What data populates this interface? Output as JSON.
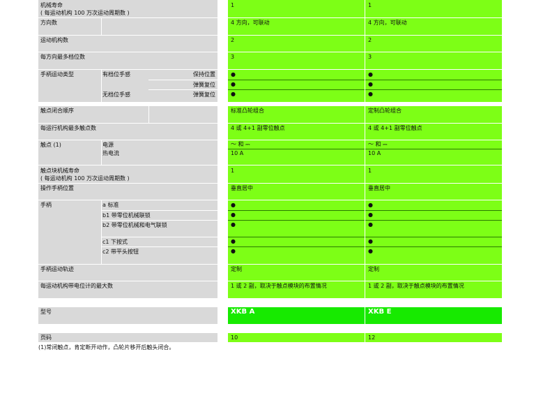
{
  "rows": {
    "mech_life": {
      "label": "机械寿命",
      "sub": "( 每运动机构 100 万次运动周期数 )",
      "a": "1",
      "e": "1"
    },
    "directions": {
      "label": "方向数",
      "a": "4 方向，可联动",
      "e": "4 方向，可联动"
    },
    "mechanisms": {
      "label": "运动机构数",
      "a": "2",
      "e": "2"
    },
    "positions": {
      "label": "每方向最多档位数",
      "a": "3",
      "e": "3"
    },
    "handle_type": {
      "label": "手柄运动类型",
      "detent": "有档位手感",
      "no_detent": "无档位手感",
      "hold": "保持位置",
      "spring1": "弹簧复位",
      "spring2": "弹簧复位",
      "a": [
        "●",
        "●",
        "●"
      ],
      "e": [
        "●",
        "●",
        "●"
      ]
    },
    "contact_seq": {
      "label": "触点闭合顺序",
      "a": "标准凸轮组合",
      "e": "定制凸轮组合"
    },
    "max_contacts": {
      "label": "每运行机构最多触点数",
      "a": "4 或 4+1 副零位触点",
      "e": "4 或 4+1 副零位触点"
    },
    "contacts": {
      "label": "触点 (1)",
      "power": "电源",
      "thermal": "热电流",
      "a": [
        "～ 和 ⎓",
        "10 A"
      ],
      "e": [
        "～ 和 ⎓",
        "10 A"
      ]
    },
    "block_life": {
      "label": "触点块机械寿命",
      "sub": "( 每运动机构 100 万次运动周期数 )",
      "a": "1",
      "e": "1"
    },
    "operator_pos": {
      "label": "操作手柄位置",
      "a": "垂直居中",
      "e": "垂直居中"
    },
    "handle": {
      "label": "手柄",
      "items": [
        "a 标准",
        "b1 带零位机械联锁",
        "b2 带零位机械和电气联锁",
        "c1 下按式",
        "c2 带平头按钮"
      ],
      "a": [
        "●",
        "●",
        "●",
        "●",
        "●"
      ],
      "e": [
        "●",
        "●",
        "●",
        "●",
        "●"
      ]
    },
    "trajectory": {
      "label": "手柄运动轨迹",
      "a": "定制",
      "e": "定制"
    },
    "max_pots": {
      "label": "每运动机构带电位计的最大数",
      "a": "1 或 2 副，取决于触点模块的布置情况",
      "e": "1 或 2 副，取决于触点模块的布置情况"
    },
    "model": {
      "label": "型号",
      "a": "XKB A",
      "e": "XKB E"
    },
    "page": {
      "label": "页码",
      "a": "10",
      "e": "12"
    }
  },
  "footnote": "(1)常闭触点，肯定断开动作，凸轮片移开后触头闭合。",
  "colors": {
    "label_bg": "#d9d9d9",
    "value_bg": "#7dff16",
    "model_bg": "#17ea00"
  }
}
